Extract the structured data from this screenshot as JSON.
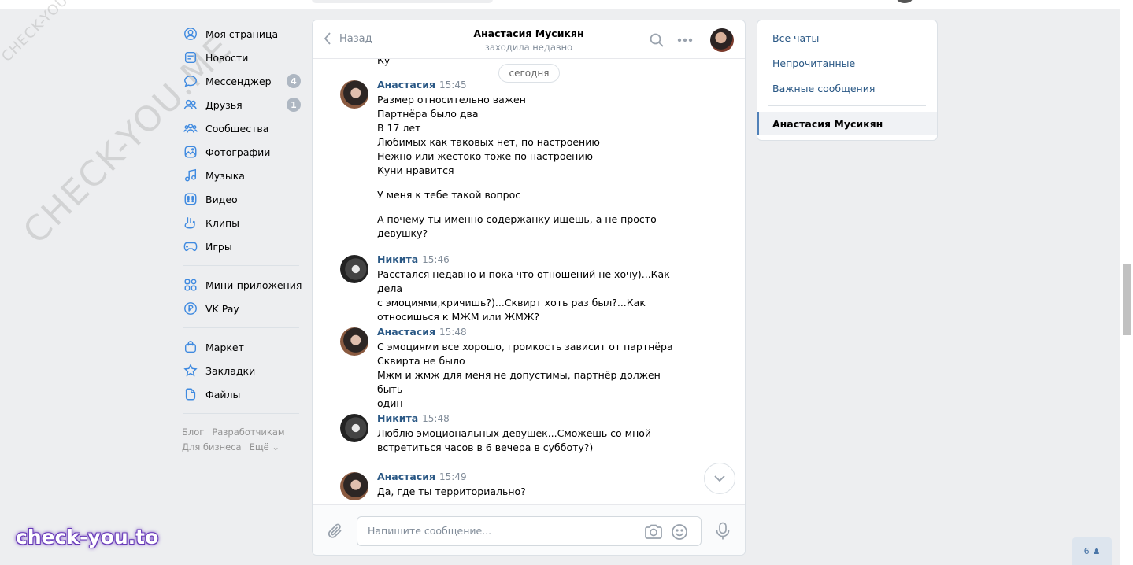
{
  "nav": {
    "items": [
      {
        "label": "Моя страница",
        "icon": "profile-icon"
      },
      {
        "label": "Новости",
        "icon": "news-icon"
      },
      {
        "label": "Мессенджер",
        "icon": "messenger-icon",
        "badge": "4"
      },
      {
        "label": "Друзья",
        "icon": "friends-icon",
        "badge": "1"
      },
      {
        "label": "Сообщества",
        "icon": "groups-icon"
      },
      {
        "label": "Фотографии",
        "icon": "photos-icon"
      },
      {
        "label": "Музыка",
        "icon": "music-icon"
      },
      {
        "label": "Видео",
        "icon": "video-icon"
      },
      {
        "label": "Клипы",
        "icon": "clips-icon"
      },
      {
        "label": "Игры",
        "icon": "games-icon"
      },
      {
        "label": "Мини-приложения",
        "icon": "mini-apps-icon"
      },
      {
        "label": "VK Pay",
        "icon": "vkpay-icon"
      },
      {
        "label": "Маркет",
        "icon": "market-icon"
      },
      {
        "label": "Закладки",
        "icon": "bookmarks-icon"
      },
      {
        "label": "Файлы",
        "icon": "files-icon"
      }
    ],
    "footer": {
      "blog": "Блог",
      "developers": "Разработчикам",
      "business": "Для бизнеса",
      "more": "Ещё ⌄"
    }
  },
  "chat": {
    "back_label": "Назад",
    "title": "Анастасия Мусикян",
    "status": "заходила недавно",
    "cut_text": "Ку",
    "date_separator": "сегодня",
    "messages": [
      {
        "author": "Анастасия",
        "time": "15:45",
        "paragraphs": [
          [
            "Размер относительно важен",
            "Партнёра было два",
            "В 17 лет",
            "Любимых как таковых нет, по настроению",
            "Нежно или жестоко тоже по настроению",
            "Куни нравится"
          ],
          [
            "У меня к тебе такой вопрос"
          ],
          [
            "А почему ты именно содержанку ищешь, а не просто",
            "девушку?"
          ]
        ]
      },
      {
        "author": "Никита",
        "time": "15:46",
        "paragraphs": [
          [
            "Расстался недавно и пока что отношений не хочу)...Как дела",
            "с эмоциями,кричишь?)...Сквирт хоть раз был?...Как",
            "относишься к МЖМ или ЖМЖ?"
          ]
        ]
      },
      {
        "author": "Анастасия",
        "time": "15:48",
        "paragraphs": [
          [
            "С эмоциями все хорошо, громкость зависит от партнёра",
            "Сквирта не было",
            "Мжм и жмж для меня не допустимы, партнёр должен быть",
            "один"
          ]
        ]
      },
      {
        "author": "Никита",
        "time": "15:48",
        "paragraphs": [
          [
            "Люблю эмоциональных девушек...Сможешь со мной",
            "встретиться часов в 6 вечера в субботу?)"
          ]
        ]
      },
      {
        "author": "Анастасия",
        "time": "15:49",
        "paragraphs": [
          [
            "Да, где ты территориально?"
          ]
        ]
      }
    ],
    "composer_placeholder": "Напишите сообщение..."
  },
  "right_panel": {
    "all_chats": "Все чаты",
    "unread": "Непрочитанные",
    "important": "Важные сообщения",
    "active_chat": "Анастасия Мусикян"
  },
  "watermarks": {
    "small": "CHECK-YOU.ME",
    "large": "CHECK-YOU.ME",
    "brand": "check-you.to"
  },
  "online_counter": "6"
}
